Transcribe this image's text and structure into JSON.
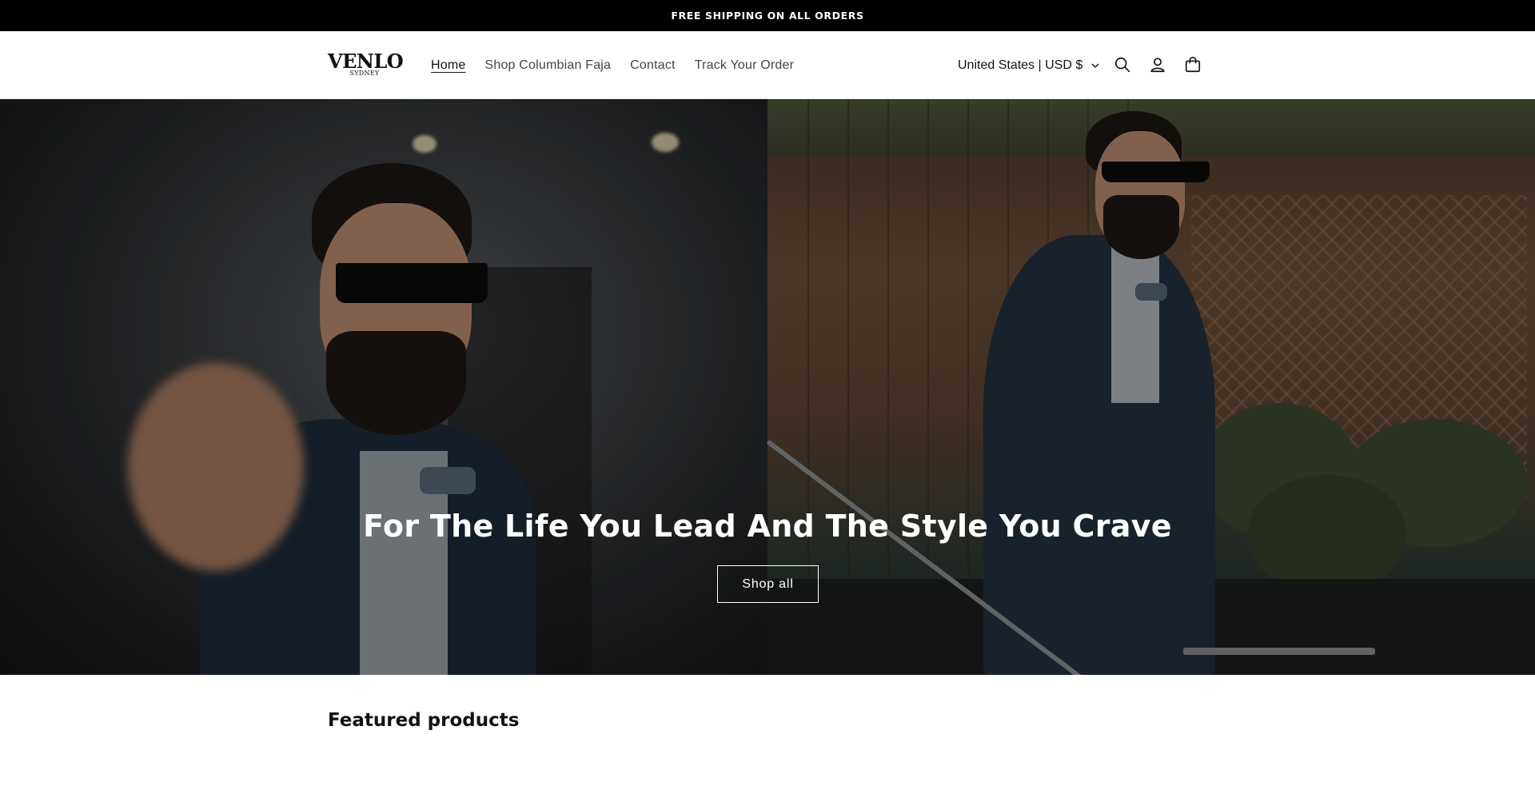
{
  "announcement": {
    "text": "FREE SHIPPING ON ALL ORDERS"
  },
  "header": {
    "logo": {
      "main": "VENLO",
      "sub": "SYDNEY"
    },
    "nav": [
      {
        "label": "Home",
        "active": true
      },
      {
        "label": "Shop Columbian Faja",
        "active": false
      },
      {
        "label": "Contact",
        "active": false
      },
      {
        "label": "Track Your Order",
        "active": false
      }
    ],
    "country_selector": {
      "label": "United States | USD $"
    },
    "icons": [
      "search-icon",
      "account-icon",
      "cart-icon"
    ]
  },
  "hero": {
    "title": "For The Life You Lead And The Style You Crave",
    "button_label": "Shop all"
  },
  "featured": {
    "title": "Featured products"
  },
  "colors": {
    "announcement_bg": "#000000",
    "text": "#121212",
    "white": "#ffffff"
  }
}
